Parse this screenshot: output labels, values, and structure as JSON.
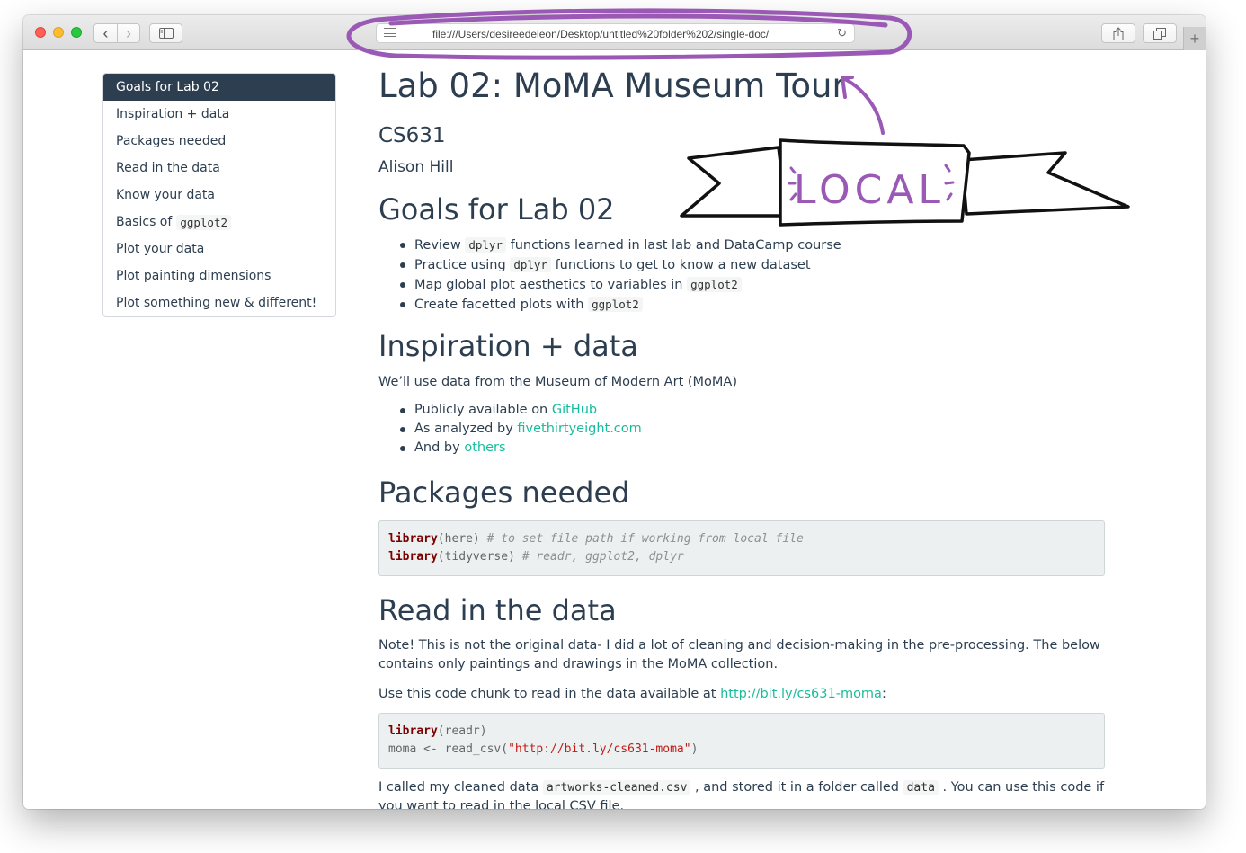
{
  "browser": {
    "url": "file:///Users/desireedeleon/Desktop/untitled%20folder%202/single-doc/",
    "back_glyph": "‹",
    "forward_glyph": "›",
    "reload_glyph": "↻",
    "new_tab_glyph": "+"
  },
  "toc": {
    "items": [
      {
        "label": "Goals for Lab 02",
        "code": ""
      },
      {
        "label": "Inspiration + data",
        "code": ""
      },
      {
        "label": "Packages needed",
        "code": ""
      },
      {
        "label": "Read in the data",
        "code": ""
      },
      {
        "label": "Know your data",
        "code": ""
      },
      {
        "label": "Basics of",
        "code": "ggplot2"
      },
      {
        "label": "Plot your data",
        "code": ""
      },
      {
        "label": "Plot painting dimensions",
        "code": ""
      },
      {
        "label": "Plot something new & different!",
        "code": ""
      }
    ]
  },
  "doc": {
    "title": "Lab 02: MoMA Museum Tour",
    "subtitle": "CS631",
    "author": "Alison Hill",
    "goals": {
      "heading": "Goals for Lab 02",
      "b1": {
        "pre": "Review",
        "code": "dplyr",
        "post": "functions learned in last lab and DataCamp course"
      },
      "b2": {
        "pre": "Practice using",
        "code": "dplyr",
        "post": "functions to get to know a new dataset"
      },
      "b3": {
        "pre": "Map global plot aesthetics to variables in",
        "code": "ggplot2"
      },
      "b4": {
        "pre": "Create facetted plots with",
        "code": "ggplot2"
      }
    },
    "inspiration": {
      "heading": "Inspiration + data",
      "intro": "We’ll use data from the Museum of Modern Art (MoMA)",
      "b1": {
        "pre": "Publicly available on",
        "link": "GitHub"
      },
      "b2": {
        "pre": "As analyzed by",
        "link": "fivethirtyeight.com"
      },
      "b3": {
        "pre": "And by",
        "link": "others"
      }
    },
    "packages": {
      "heading": "Packages needed",
      "line1": {
        "kw": "library",
        "arg": "(here)",
        "comment": "# to set file path if working from local file"
      },
      "line2": {
        "kw": "library",
        "arg": "(tidyverse)",
        "comment": "# readr, ggplot2, dplyr"
      }
    },
    "read": {
      "heading": "Read in the data",
      "note": "Note! This is not the original data- I did a lot of cleaning and decision-making in the pre-processing. The below contains only paintings and drawings in the MoMA collection.",
      "use_pre": "Use this code chunk to read in the data available at",
      "use_link": "http://bit.ly/cs631-moma",
      "use_post": ":",
      "code1": {
        "kw": "library",
        "arg": "(readr)"
      },
      "code2": {
        "lhs": "moma <- read_csv(",
        "str": "\"http://bit.ly/cs631-moma\"",
        "rhs": ")"
      },
      "called_pre": "I called my cleaned data",
      "called_code1": "artworks-cleaned.csv",
      "called_mid": ", and stored it in a folder called",
      "called_code2": "data",
      "called_post": ". You can use this code if you want to read in the local CSV file."
    }
  },
  "annotation": {
    "banner_text": "LOCAL",
    "ink_color": "#111111",
    "purple": "#9b59b6"
  }
}
